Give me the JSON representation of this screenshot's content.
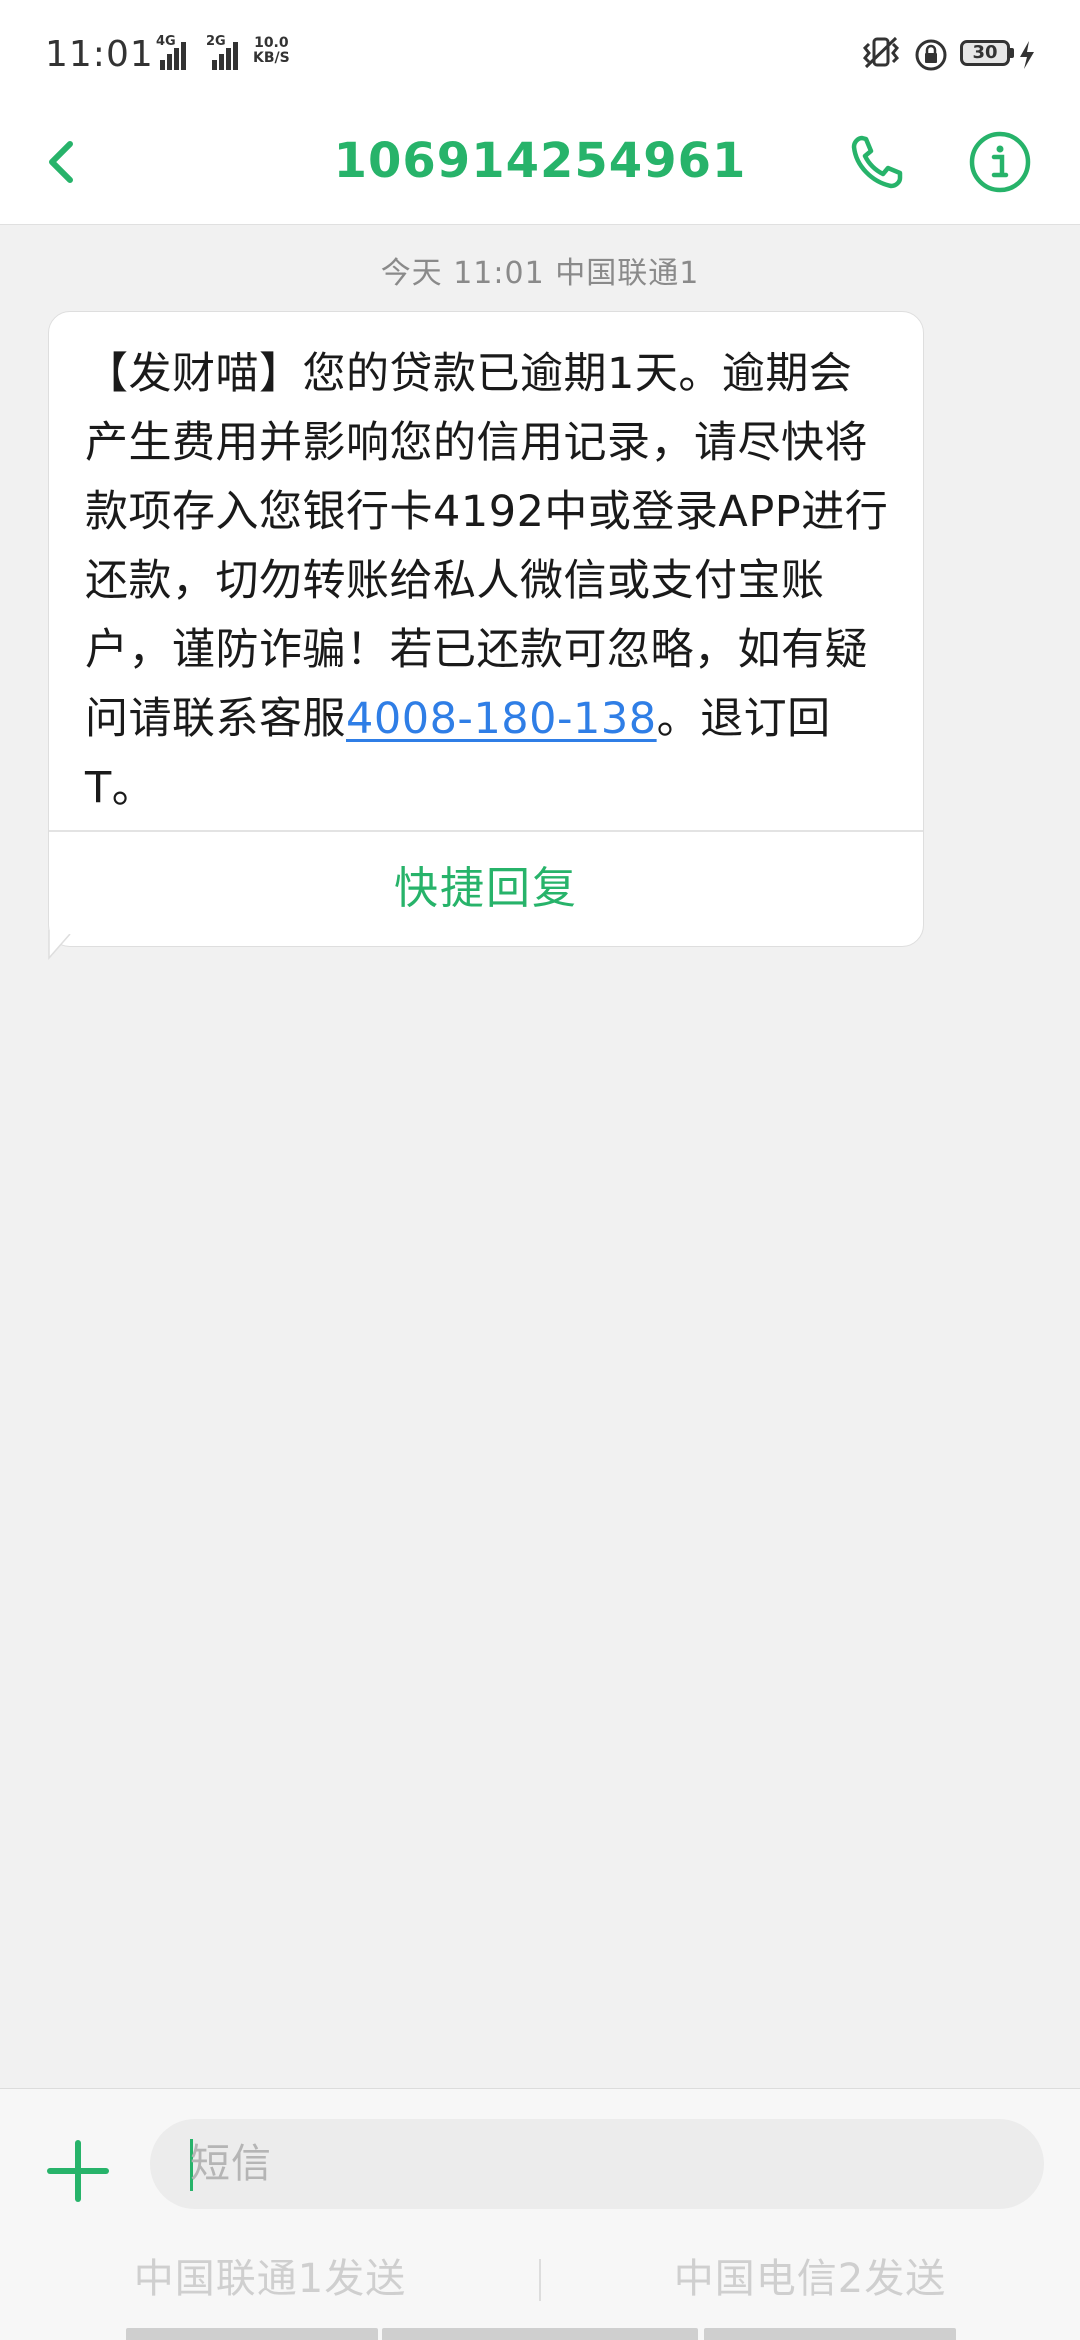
{
  "status_bar": {
    "time": "11:01",
    "sim1_tech": "4G",
    "sim2_tech": "2G",
    "net_speed_value": "10.0",
    "net_speed_unit": "KB/S",
    "battery": "30"
  },
  "header": {
    "title": "106914254961"
  },
  "message": {
    "meta": "今天 11:01  中国联通1",
    "text_before_link": "【发财喵】您的贷款已逾期1天。逾期会产生费用并影响您的信用记录，请尽快将款项存入您银行卡4192中或登录APP进行还款，切勿转账给私人微信或支付宝账户，谨防诈骗！若已还款可忽略，如有疑问请联系客服",
    "link": "4008-180-138",
    "text_after_link": "。退订回T。",
    "quick_reply": "快捷回复"
  },
  "composer": {
    "placeholder": "短信",
    "send_sim1": "中国联通1发送",
    "send_sim2": "中国电信2发送"
  },
  "colors": {
    "accent": "#27b36a",
    "link": "#2f7ee6",
    "background": "#f1f1f1"
  },
  "icons": {
    "back": "chevron-left-icon",
    "call": "phone-icon",
    "info": "info-icon",
    "add": "plus-icon",
    "vibrate": "vibrate-icon",
    "rotation_lock": "rotation-lock-icon",
    "charging": "charging-icon"
  }
}
